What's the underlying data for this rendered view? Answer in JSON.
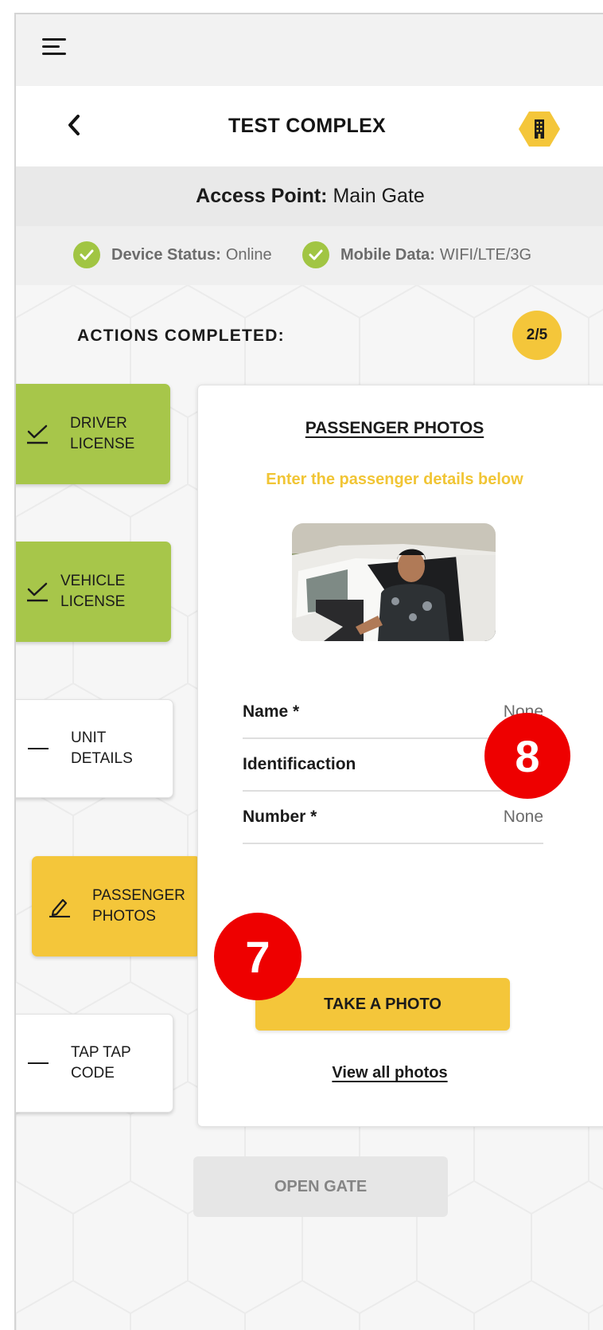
{
  "header": {
    "title": "TEST COMPLEX"
  },
  "access_point": {
    "label": "Access Point:",
    "value": "Main Gate"
  },
  "status": {
    "device": {
      "label": "Device Status:",
      "value": "Online"
    },
    "mobile": {
      "label": "Mobile Data:",
      "value": "WIFI/LTE/3G"
    }
  },
  "actions": {
    "label": "ACTIONS COMPLETED:",
    "progress": "2/5"
  },
  "steps": [
    {
      "label": "DRIVER LICENSE",
      "state": "done"
    },
    {
      "label": "VEHICLE LICENSE",
      "state": "done"
    },
    {
      "label": "UNIT DETAILS",
      "state": "pending"
    },
    {
      "label": "PASSENGER PHOTOS",
      "state": "active"
    },
    {
      "label": "TAP TAP CODE",
      "state": "pending"
    }
  ],
  "card": {
    "title": "PASSENGER PHOTOS",
    "subtitle": "Enter the passenger details below",
    "fields": [
      {
        "label": "Name *",
        "value": "None"
      },
      {
        "label": "Identificaction",
        "value": ""
      },
      {
        "label": "Number *",
        "value": "None"
      }
    ],
    "take_photo_label": "TAKE A PHOTO",
    "view_all_label": "View all photos"
  },
  "open_gate_label": "OPEN GATE",
  "markers": [
    "8",
    "7"
  ],
  "colors": {
    "accent_yellow": "#f4c63a",
    "done_green": "#a7c64a",
    "status_green": "#a1c543",
    "marker_red": "#ee0000"
  },
  "icons": {
    "menu": "hamburger-icon",
    "back": "chevron-left-icon",
    "complex": "building-icon",
    "status": "check-circle-icon",
    "done": "check-icon",
    "pending": "dash-icon",
    "active": "pencil-icon"
  }
}
